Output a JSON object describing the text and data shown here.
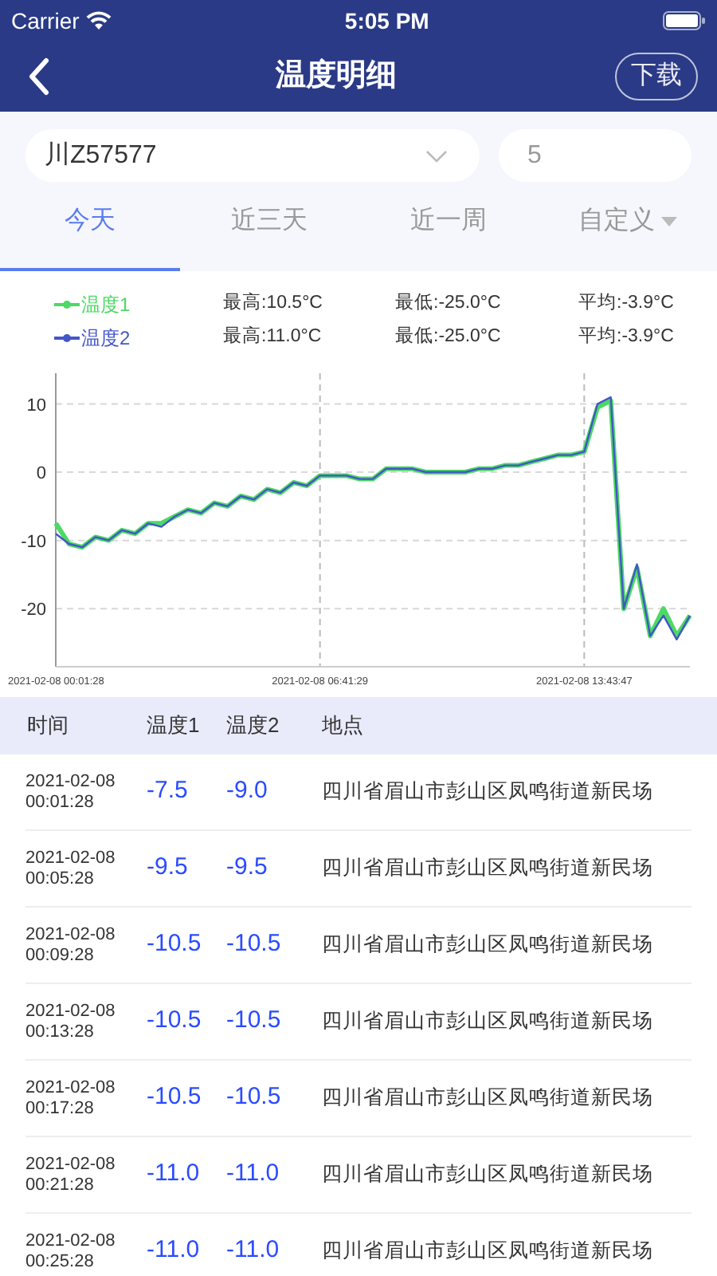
{
  "status_bar": {
    "carrier": "Carrier",
    "time": "5:05 PM"
  },
  "nav": {
    "title": "温度明细",
    "action": "下载"
  },
  "filters": {
    "vehicle": "川Z57577",
    "count": "5"
  },
  "tabs": [
    {
      "label": "今天",
      "selected": true,
      "kind": "plain"
    },
    {
      "label": "近三天",
      "selected": false,
      "kind": "plain"
    },
    {
      "label": "近一周",
      "selected": false,
      "kind": "plain"
    },
    {
      "label": "自定义",
      "selected": false,
      "kind": "dropdown"
    }
  ],
  "legend": [
    {
      "max": "最高:10.5°C",
      "min": "最低:-25.0°C",
      "avg": "平均:-3.9°C"
    },
    {
      "max": "最高:11.0°C",
      "min": "最低:-25.0°C",
      "avg": "平均:-3.9°C"
    }
  ],
  "chart_data": {
    "type": "line",
    "categories": [
      "2021-02-08 00:01:28",
      null,
      null,
      null,
      null,
      null,
      null,
      null,
      null,
      null,
      null,
      null,
      null,
      null,
      null,
      null,
      null,
      null,
      null,
      null,
      "2021-02-08 06:41:29",
      null,
      null,
      null,
      null,
      null,
      null,
      null,
      null,
      null,
      null,
      null,
      null,
      null,
      null,
      null,
      null,
      null,
      null,
      null,
      "2021-02-08 13:43:47",
      null,
      null,
      null,
      null,
      null,
      null,
      null,
      null
    ],
    "series": [
      {
        "name": "温度1",
        "color": "#4cd964",
        "values": [
          -7.5,
          -10.5,
          -11,
          -9.5,
          -10,
          -8.5,
          -9,
          -7.5,
          -7.5,
          -6.5,
          -5.5,
          -6,
          -4.5,
          -5,
          -3.5,
          -4,
          -2.5,
          -3,
          -1.5,
          -2,
          -0.5,
          -0.5,
          -0.5,
          -1,
          -1,
          0.5,
          0.5,
          0.5,
          0,
          0,
          0,
          0,
          0.5,
          0.5,
          1,
          1,
          1.5,
          2,
          2.5,
          2.5,
          3,
          9.5,
          10.5,
          -20,
          -14,
          -24,
          -20,
          -24,
          -21
        ]
      },
      {
        "name": "温度2",
        "color": "#4356c8",
        "values": [
          -9,
          -10.5,
          -11,
          -9.5,
          -10,
          -8.5,
          -9,
          -7.5,
          -8,
          -6.5,
          -5.5,
          -6,
          -4.5,
          -5,
          -3.5,
          -4,
          -2.5,
          -3,
          -1.5,
          -2,
          -0.5,
          -0.5,
          -0.5,
          -1,
          -1,
          0.5,
          0.5,
          0.5,
          0,
          0,
          0,
          0,
          0.5,
          0.5,
          1,
          1,
          1.5,
          2,
          2.5,
          2.5,
          3,
          10,
          11,
          -20,
          -13.5,
          -24,
          -21,
          -24.5,
          -21
        ]
      }
    ],
    "ylim": [
      -28.5,
      14.5
    ],
    "yticks": [
      10,
      0,
      -10,
      -20
    ],
    "grid": true
  },
  "table": {
    "columns": [
      "时间",
      "温度1",
      "温度2",
      "地点"
    ],
    "rows": [
      {
        "date": "2021-02-08",
        "time": "00:01:28",
        "t1": "-7.5",
        "t2": "-9.0",
        "place": "四川省眉山市彭山区凤鸣街道新民场"
      },
      {
        "date": "2021-02-08",
        "time": "00:05:28",
        "t1": "-9.5",
        "t2": "-9.5",
        "place": "四川省眉山市彭山区凤鸣街道新民场"
      },
      {
        "date": "2021-02-08",
        "time": "00:09:28",
        "t1": "-10.5",
        "t2": "-10.5",
        "place": "四川省眉山市彭山区凤鸣街道新民场"
      },
      {
        "date": "2021-02-08",
        "time": "00:13:28",
        "t1": "-10.5",
        "t2": "-10.5",
        "place": "四川省眉山市彭山区凤鸣街道新民场"
      },
      {
        "date": "2021-02-08",
        "time": "00:17:28",
        "t1": "-10.5",
        "t2": "-10.5",
        "place": "四川省眉山市彭山区凤鸣街道新民场"
      },
      {
        "date": "2021-02-08",
        "time": "00:21:28",
        "t1": "-11.0",
        "t2": "-11.0",
        "place": "四川省眉山市彭山区凤鸣街道新民场"
      },
      {
        "date": "2021-02-08",
        "time": "00:25:28",
        "t1": "-11.0",
        "t2": "-11.0",
        "place": "四川省眉山市彭山区凤鸣街道新民场"
      }
    ]
  }
}
